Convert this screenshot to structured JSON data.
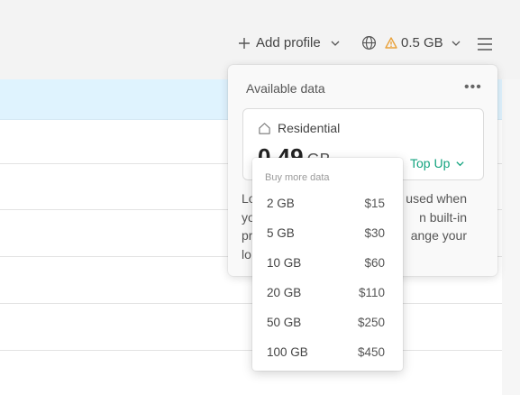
{
  "header": {
    "add_profile_label": "Add profile",
    "data_amount": "0.5 GB",
    "warning_color": "#e9a23b"
  },
  "card": {
    "title": "Available data",
    "more_label": "•••",
    "residential": {
      "label": "Residential",
      "value": "0.49",
      "unit": "GB",
      "topup_label": "Top Up"
    },
    "text_lines": [
      "Lo",
      "used when",
      "yo",
      "n built-in",
      "pr",
      "ange your",
      "lo"
    ]
  },
  "dropdown": {
    "heading": "Buy more data",
    "options": [
      {
        "size": "2 GB",
        "price": "$15"
      },
      {
        "size": "5 GB",
        "price": "$30"
      },
      {
        "size": "10 GB",
        "price": "$60"
      },
      {
        "size": "20 GB",
        "price": "$110"
      },
      {
        "size": "50 GB",
        "price": "$250"
      },
      {
        "size": "100 GB",
        "price": "$450"
      }
    ]
  },
  "colors": {
    "accent_green": "#13a37f",
    "highlight_row": "#dff3fe"
  }
}
